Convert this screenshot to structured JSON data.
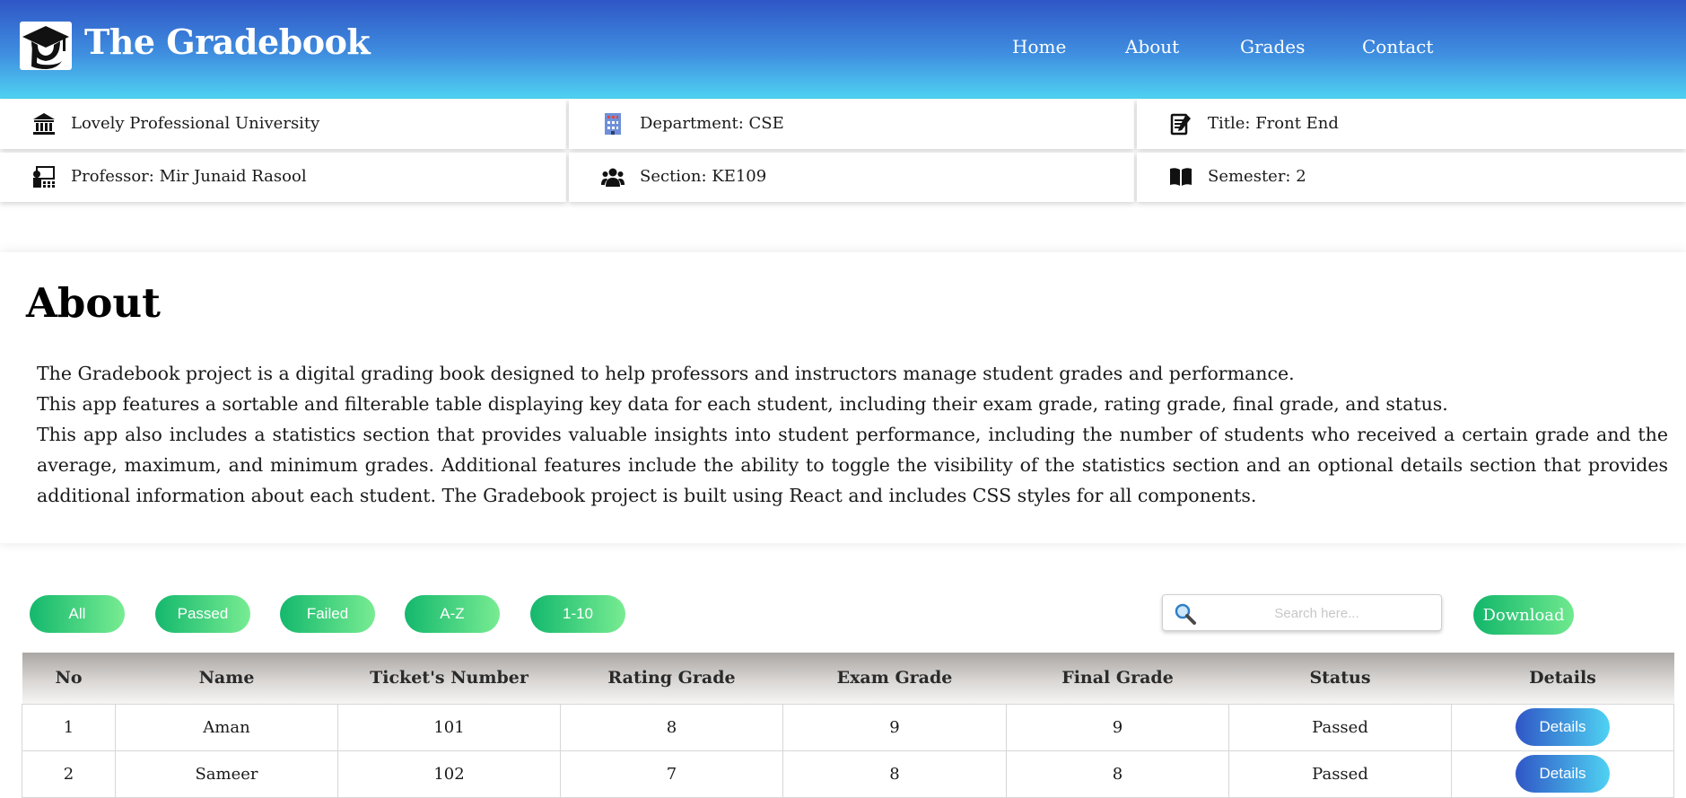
{
  "header": {
    "brand": "The Gradebook",
    "nav": [
      "Home",
      "About",
      "Grades",
      "Contact"
    ]
  },
  "info": {
    "university": "Lovely Professional University",
    "department": "Department: CSE",
    "title": "Title: Front End",
    "professor": "Professor: Mir Junaid Rasool",
    "section": "Section: KE109",
    "semester": "Semester: 2"
  },
  "about": {
    "title": "About",
    "paragraphs": [
      "The Gradebook project is a digital grading book designed to help professors and instructors manage student grades and performance.",
      "This app features a sortable and filterable table displaying key data for each student, including their exam grade, rating grade, final grade, and status.",
      "This app also includes a statistics section that provides valuable insights into student performance, including the number of students who received a certain grade and the average, maximum, and minimum grades. Additional features include the ability to toggle the visibility of the statistics section and an optional details section that provides additional information about each student. The Gradebook project is built using React and includes CSS styles for all components."
    ]
  },
  "filters": [
    "All",
    "Passed",
    "Failed",
    "A-Z",
    "1-10"
  ],
  "search": {
    "placeholder": "Search here..."
  },
  "download_label": "Download",
  "table": {
    "headers": [
      "No",
      "Name",
      "Ticket's Number",
      "Rating Grade",
      "Exam Grade",
      "Final Grade",
      "Status",
      "Details"
    ],
    "rows": [
      {
        "no": "1",
        "name": "Aman",
        "ticket": "101",
        "rating": "8",
        "exam": "9",
        "final": "9",
        "status": "Passed",
        "details": "Details"
      },
      {
        "no": "2",
        "name": "Sameer",
        "ticket": "102",
        "rating": "7",
        "exam": "8",
        "final": "8",
        "status": "Passed",
        "details": "Details"
      }
    ]
  },
  "colors": {
    "header_top": "#2f56c6",
    "header_bottom": "#4fd2f2",
    "filter_green": "#14b86d",
    "details_blue": "#2f56c6"
  }
}
